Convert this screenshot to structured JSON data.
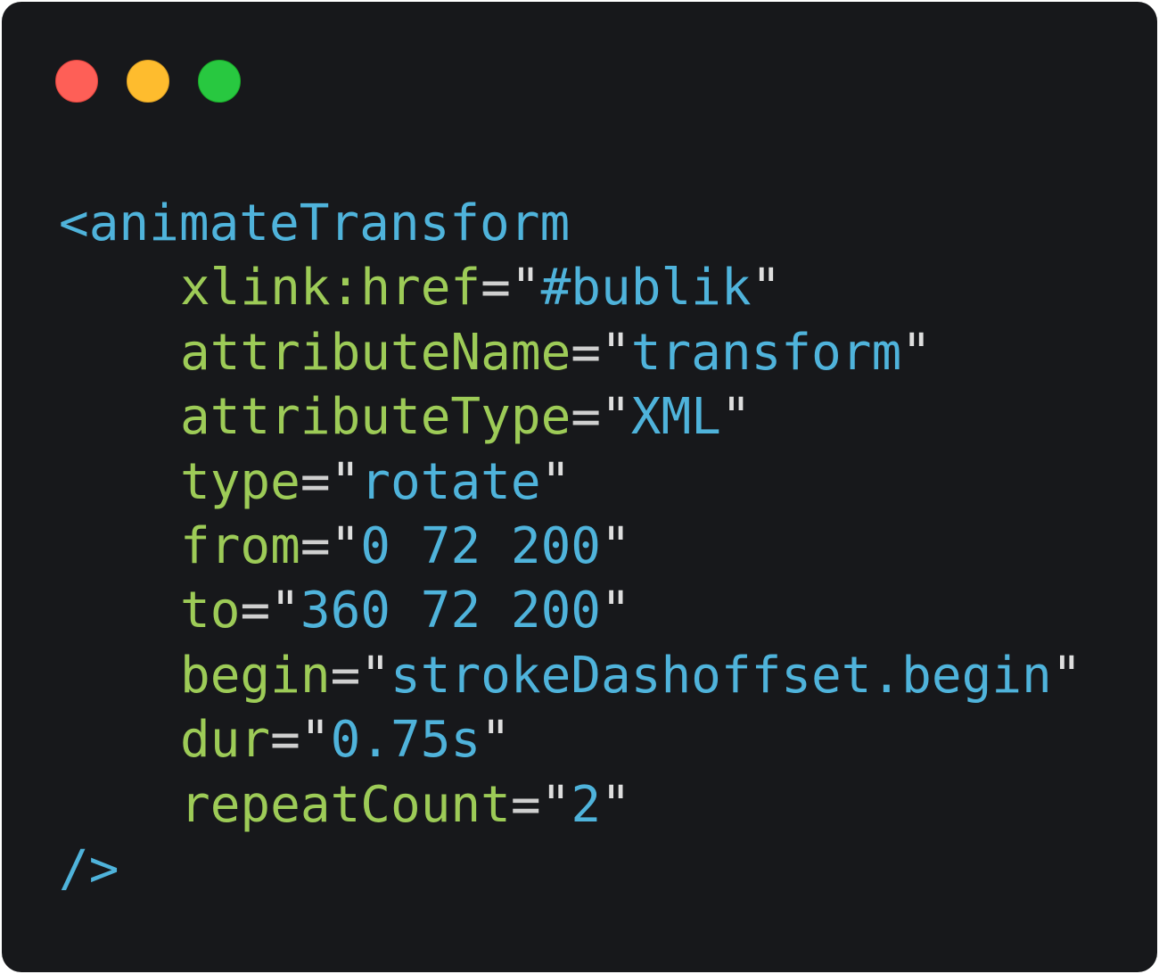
{
  "window": {
    "controls": {
      "close_color": "#fe5f57",
      "minimize_color": "#febc2e",
      "maximize_color": "#28c840"
    }
  },
  "code": {
    "open_tag": "<animateTransform",
    "attributes": [
      {
        "name": "xlink:href",
        "value": "#bublik"
      },
      {
        "name": "attributeName",
        "value": "transform"
      },
      {
        "name": "attributeType",
        "value": "XML"
      },
      {
        "name": "type",
        "value": "rotate"
      },
      {
        "name": "from",
        "value": "0 72 200"
      },
      {
        "name": "to",
        "value": "360 72 200"
      },
      {
        "name": "begin",
        "value": "strokeDashoffset.begin"
      },
      {
        "name": "dur",
        "value": "0.75s"
      },
      {
        "name": "repeatCount",
        "value": "2"
      }
    ],
    "close_tag": "/>"
  },
  "colors": {
    "background": "#17181b",
    "tag": "#4fb3db",
    "attribute": "#9dcb57",
    "string": "#4fb3db",
    "punctuation": "#cfcfcf"
  }
}
